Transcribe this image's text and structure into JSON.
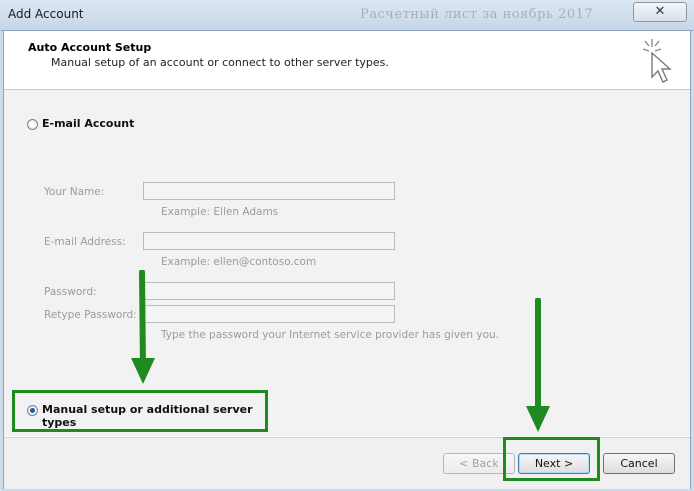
{
  "window": {
    "title": "Add Account",
    "background_title": "Расчетный лист за ноябрь 2017",
    "close_glyph": "✕"
  },
  "header": {
    "title": "Auto Account Setup",
    "subtitle": "Manual setup of an account or connect to other server types."
  },
  "options": {
    "email_account_label": "E-mail Account",
    "email_account_selected": false,
    "manual_setup_label": "Manual setup or additional server types",
    "manual_setup_selected": true
  },
  "fields": {
    "your_name": {
      "label": "Your Name:",
      "value": "",
      "hint": "Example: Ellen Adams"
    },
    "email_address": {
      "label": "E-mail Address:",
      "value": "",
      "hint": "Example: ellen@contoso.com"
    },
    "password": {
      "label": "Password:",
      "value": ""
    },
    "retype_password": {
      "label": "Retype Password:",
      "value": "",
      "hint": "Type the password your Internet service provider has given you."
    }
  },
  "buttons": {
    "back": "< Back",
    "next": "Next >",
    "cancel": "Cancel"
  },
  "annotation": {
    "highlight_color": "#1f8a1f"
  }
}
